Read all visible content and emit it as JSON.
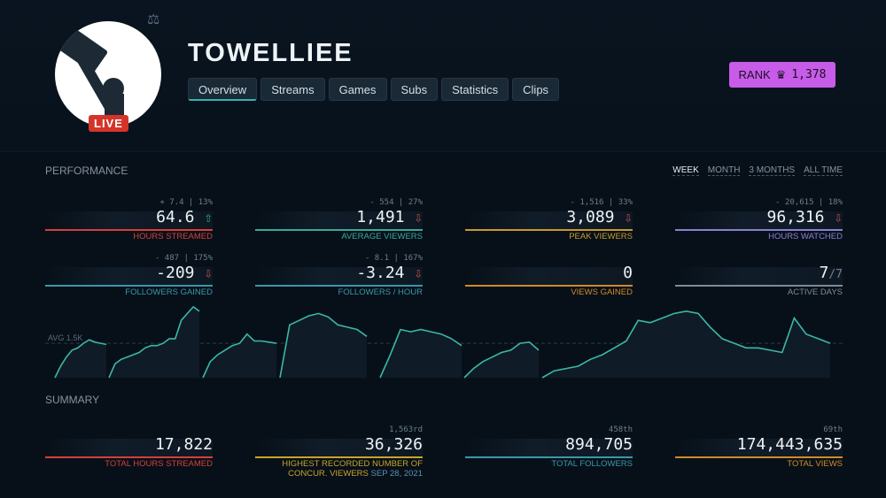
{
  "channel": {
    "name": "TOWELLIEE",
    "live_label": "LIVE",
    "rank_label": "RANK",
    "rank_value": "1,378"
  },
  "tabs": [
    {
      "label": "Overview",
      "active": true
    },
    {
      "label": "Streams"
    },
    {
      "label": "Games"
    },
    {
      "label": "Subs"
    },
    {
      "label": "Statistics"
    },
    {
      "label": "Clips"
    }
  ],
  "performance": {
    "title": "PERFORMANCE",
    "periods": [
      "WEEK",
      "MONTH",
      "3 MONTHS",
      "ALL TIME"
    ],
    "active_period": "WEEK",
    "cards": [
      {
        "delta": "+ 7.4 | 13%",
        "value": "64.6",
        "arrow": "⇧",
        "arrow_color": "#3aa89a",
        "label": "HOURS STREAMED",
        "color": "#d4403a"
      },
      {
        "delta": "- 554 | 27%",
        "value": "1,491",
        "arrow": "⇩",
        "arrow_color": "#c0504a",
        "label": "AVERAGE VIEWERS",
        "color": "#3aa89a"
      },
      {
        "delta": "- 1,516 | 33%",
        "value": "3,089",
        "arrow": "⇩",
        "arrow_color": "#c0504a",
        "label": "PEAK VIEWERS",
        "color": "#c99a2a"
      },
      {
        "delta": "- 20,615 | 18%",
        "value": "96,316",
        "arrow": "⇩",
        "arrow_color": "#c0504a",
        "label": "HOURS WATCHED",
        "color": "#8a80d0"
      },
      {
        "delta": "- 487 | 175%",
        "value": "-209",
        "arrow": "⇩",
        "arrow_color": "#c0504a",
        "label": "FOLLOWERS GAINED",
        "color": "#3a98a8"
      },
      {
        "delta": "- 8.1 | 167%",
        "value": "-3.24",
        "arrow": "⇩",
        "arrow_color": "#c0504a",
        "label": "FOLLOWERS / HOUR",
        "color": "#3a98a8"
      },
      {
        "delta": "",
        "value": "0",
        "arrow": "",
        "label": "VIEWS GAINED",
        "color": "#d08a2a"
      },
      {
        "delta": "",
        "value": "7",
        "sub": "/7",
        "arrow": "",
        "label": "ACTIVE DAYS",
        "color": "#7c8c98"
      }
    ]
  },
  "chart_data": {
    "type": "area",
    "avg_label": "AVG 1.5K",
    "avg": 1500,
    "ylim": [
      0,
      3200
    ],
    "color": "#3ab8a8",
    "segments": [
      [
        0,
        500,
        900,
        1200,
        1300,
        1500,
        1650,
        1550,
        1500,
        1450
      ],
      [
        0,
        600,
        800,
        900,
        1000,
        1100,
        1300,
        1400,
        1400,
        1500,
        1700,
        1700,
        2500,
        2800,
        3089,
        2900
      ],
      [
        0,
        700,
        1000,
        1200,
        1400,
        1500,
        1900,
        1600,
        1600,
        1550,
        1500
      ],
      [
        0,
        2300,
        2500,
        2700,
        2800,
        2650,
        2300,
        2200,
        2100,
        1800
      ],
      [
        0,
        1000,
        2100,
        2000,
        2100,
        2000,
        1900,
        1700,
        1400
      ],
      [
        0,
        400,
        700,
        900,
        1100,
        1200,
        1500,
        1550,
        1200
      ],
      [
        0,
        300,
        400,
        500,
        800,
        1000,
        1300,
        1600,
        2500,
        2400,
        2600,
        2800,
        2900,
        2800,
        2200,
        1700,
        1500,
        1300,
        1300,
        1200,
        1100,
        2600,
        1900,
        1700,
        1500
      ]
    ]
  },
  "summary": {
    "title": "SUMMARY",
    "cards": [
      {
        "delta": "",
        "value": "17,822",
        "label": "TOTAL HOURS STREAMED",
        "color": "#d4403a"
      },
      {
        "delta": "1,563rd",
        "value": "36,326",
        "label": "HIGHEST RECORDED NUMBER OF CONCUR. VIEWERS",
        "date": "SEP 28, 2021",
        "color": "#c9a42a"
      },
      {
        "delta": "458th",
        "value": "894,705",
        "label": "TOTAL FOLLOWERS",
        "color": "#3a98a8"
      },
      {
        "delta": "69th",
        "value": "174,443,635",
        "label": "TOTAL VIEWS",
        "color": "#d08a2a"
      }
    ]
  }
}
